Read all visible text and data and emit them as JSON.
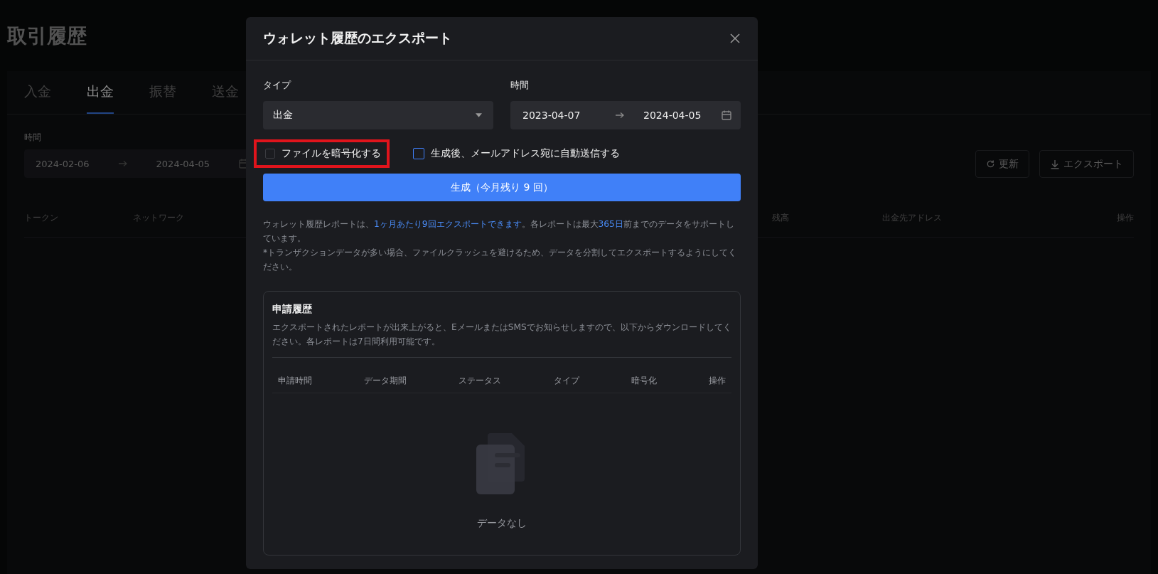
{
  "page": {
    "title": "取引履歴",
    "tabs": [
      {
        "label": "入金",
        "selected": false
      },
      {
        "label": "出金",
        "selected": true
      },
      {
        "label": "振替",
        "selected": false
      },
      {
        "label": "送金",
        "selected": false
      }
    ],
    "time_label": "時間",
    "date_range": {
      "start": "2024-02-06",
      "end": "2024-04-05"
    },
    "buttons": [
      {
        "kind": "refresh",
        "label": "更新"
      },
      {
        "kind": "export",
        "label": "エクスポート"
      }
    ],
    "columns": [
      "トークン",
      "ネットワーク",
      "残高",
      "出金先アドレス",
      "操作"
    ]
  },
  "modal": {
    "title": "ウォレット履歴のエクスポート",
    "type_label": "タイプ",
    "type_value": "出金",
    "time_label": "時間",
    "date_range": {
      "start": "2023-04-07",
      "end": "2024-04-05"
    },
    "checkboxes": [
      {
        "label": "ファイルを暗号化する",
        "checked": false,
        "focused": false,
        "annotated": true
      },
      {
        "label": "生成後、メールアドレス宛に自動送信する",
        "checked": false,
        "focused": true,
        "annotated": false
      }
    ],
    "generate_button": "生成（今月残り 9 回）",
    "notes": [
      "ウォレット履歴レポートは、**1ヶ月あたり9回エクスポートできます**。各レポートは最大**365日**前までのデータをサポートしています。",
      "*トランザクションデータが多い場合、ファイルクラッシュを避けるため、データを分割してエクスポートするようにしてください。"
    ],
    "history": {
      "title": "申請履歴",
      "description": "エクスポートされたレポートが出来上がると、EメールまたはSMSでお知らせしますので、以下からダウンロードしてください。各レポートは7日間利用可能です。",
      "columns": [
        "申請時間",
        "データ期間",
        "ステータス",
        "タイプ",
        "暗号化",
        "操作"
      ],
      "empty_text": "データなし"
    }
  }
}
